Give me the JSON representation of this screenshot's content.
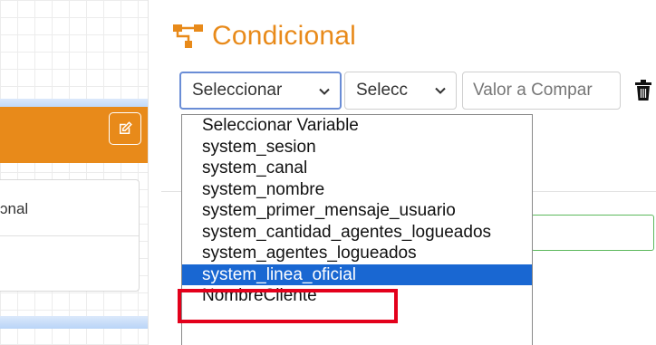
{
  "canvas": {
    "node_label": "ɔnal"
  },
  "panel": {
    "title": "Condicional",
    "variable_select": {
      "value": "Seleccionar"
    },
    "operator_select": {
      "value": "Selecc"
    },
    "compare_input": {
      "placeholder": "Valor a Compar"
    }
  },
  "dropdown": {
    "options": [
      "Seleccionar Variable",
      "system_sesion",
      "system_canal",
      "system_nombre",
      "system_primer_mensaje_usuario",
      "system_cantidad_agentes_logueados",
      "system_agentes_logueados",
      "system_linea_oficial",
      "NombreCliente"
    ],
    "selected_index": 7
  },
  "colors": {
    "accent": "#e88a1a",
    "selected_bg": "#1967d2",
    "highlight": "#e3001b",
    "valid_border": "#5cb85c"
  },
  "icons": [
    "flow-icon",
    "edit-icon",
    "chevron-down-icon",
    "trash-icon"
  ]
}
